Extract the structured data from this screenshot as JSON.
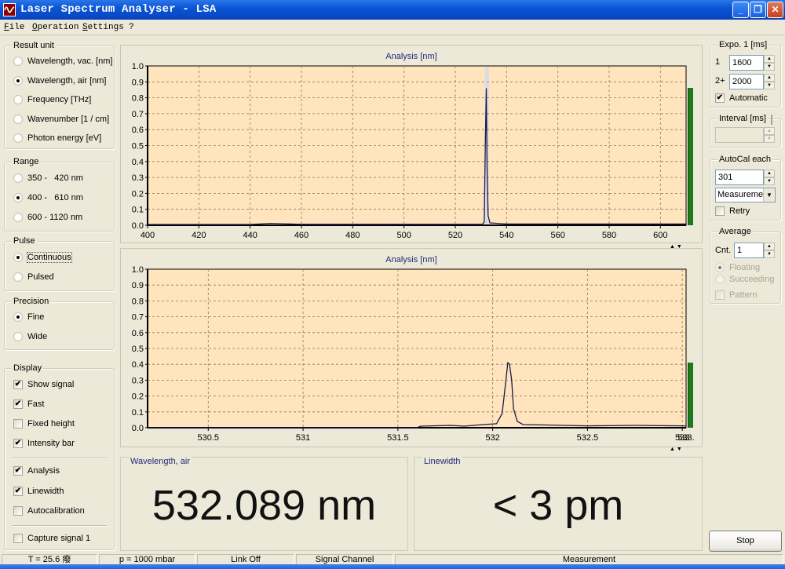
{
  "window": {
    "title": "Laser Spectrum Analyser - LSA",
    "controls": [
      "minimize",
      "restore",
      "close"
    ]
  },
  "menu": [
    "File",
    "Operation",
    "Settings",
    "?"
  ],
  "left_panel": {
    "result_unit": {
      "label": "Result unit",
      "options": [
        {
          "label": "Wavelength, vac.  [nm]",
          "selected": false
        },
        {
          "label": "Wavelength, air  [nm]",
          "selected": true
        },
        {
          "label": "Frequency  [THz]",
          "selected": false
        },
        {
          "label": "Wavenumber  [1 / cm]",
          "selected": false
        },
        {
          "label": "Photon energy  [eV]",
          "selected": false
        }
      ]
    },
    "range": {
      "label": "Range",
      "options": [
        {
          "label": "350 -   420 nm",
          "selected": false
        },
        {
          "label": "400 -   610 nm",
          "selected": true
        },
        {
          "label": "600 - 1120 nm",
          "selected": false
        }
      ]
    },
    "pulse": {
      "label": "Pulse",
      "options": [
        {
          "label": "Continuous",
          "selected": true
        },
        {
          "label": "Pulsed",
          "selected": false
        }
      ]
    },
    "precision": {
      "label": "Precision",
      "options": [
        {
          "label": "Fine",
          "selected": true
        },
        {
          "label": "Wide",
          "selected": false
        }
      ]
    },
    "display": {
      "label": "Display",
      "options": [
        {
          "label": "Show signal",
          "checked": true
        },
        {
          "label": "Fast",
          "checked": true
        },
        {
          "label": "Fixed height",
          "checked": false
        },
        {
          "label": "Intensity bar",
          "checked": true
        },
        {
          "label": "Analysis",
          "checked": true
        },
        {
          "label": "Linewidth",
          "checked": true
        },
        {
          "label": "Autocalibration",
          "checked": false
        },
        {
          "label": "Capture signal 1",
          "checked": false
        }
      ]
    }
  },
  "right_panel": {
    "expo": {
      "label": "Expo. 1  [ms]",
      "row1_label": "1",
      "row1_value": "1600",
      "row2_label": "2+",
      "row2_value": "2000",
      "automatic_label": "Automatic",
      "automatic_checked": true
    },
    "interval": {
      "label": "Interval [ms]",
      "enabled": false,
      "value": ""
    },
    "autocal": {
      "label": "AutoCal each",
      "value": "301",
      "mode": "Measurement",
      "mode_display": "Measuremer",
      "retry_label": "Retry",
      "retry_checked": false
    },
    "average": {
      "label": "Average",
      "cnt_label": "Cnt.",
      "cnt_value": "1",
      "floating_label": "Floating",
      "succeeding_label": "Succeeding",
      "pattern_label": "Pattern"
    },
    "stop_label": "Stop"
  },
  "results": {
    "wavelength_label": "Wavelength,  air",
    "wavelength_value": "532.089 nm",
    "linewidth_label": "Linewidth",
    "linewidth_value": "< 3 pm"
  },
  "status": {
    "temperature": "T = 25.6 癈",
    "pressure": "p = 1000 mbar",
    "link": "Link Off",
    "channel": "Signal Channel",
    "mode": "Measurement"
  },
  "chart_data": [
    {
      "type": "line",
      "title": "Analysis  [nm]",
      "xlabel": "",
      "ylabel": "",
      "xlim": [
        400,
        610
      ],
      "ylim": [
        0,
        1.0
      ],
      "grid": true,
      "x_ticks": [
        "400",
        "420",
        "440",
        "460",
        "480",
        "500",
        "520",
        "540",
        "560",
        "580",
        "600"
      ],
      "y_ticks": [
        "0.0",
        "0.1",
        "0.2",
        "0.3",
        "0.4",
        "0.5",
        "0.6",
        "0.7",
        "0.8",
        "0.9",
        "1.0"
      ],
      "highlight_range": [
        531.5,
        533.1
      ],
      "intensity_level": 0.86,
      "series": [
        {
          "name": "signal",
          "peak_x": 532.09,
          "peak_y": 0.86,
          "x": [
            400,
            420,
            440,
            448,
            460,
            480,
            500,
            520,
            530.5,
            531.3,
            531.7,
            532.09,
            532.4,
            532.8,
            533.5,
            540,
            560,
            580,
            600,
            610
          ],
          "y": [
            0.005,
            0.005,
            0.005,
            0.012,
            0.006,
            0.006,
            0.006,
            0.006,
            0.006,
            0.02,
            0.5,
            0.86,
            0.35,
            0.06,
            0.015,
            0.008,
            0.008,
            0.008,
            0.008,
            0.008
          ]
        }
      ]
    },
    {
      "type": "line",
      "title": "Analysis  [nm]",
      "xlabel": "",
      "ylabel": "",
      "xlim": [
        530.18,
        533.02
      ],
      "ylim": [
        0,
        1.0
      ],
      "grid": true,
      "x_ticks": [
        "530.5",
        "531",
        "531.5",
        "532",
        "532.5",
        "533"
      ],
      "x_tick_last_label": "533.",
      "y_ticks": [
        "0.0",
        "0.1",
        "0.2",
        "0.3",
        "0.4",
        "0.5",
        "0.6",
        "0.7",
        "0.8",
        "0.9",
        "1.0"
      ],
      "intensity_level": 0.41,
      "series": [
        {
          "name": "signal",
          "peak_x": 532.089,
          "peak_y": 0.41,
          "x": [
            530.18,
            531.0,
            531.6,
            531.62,
            531.78,
            531.85,
            531.95,
            532.02,
            532.05,
            532.07,
            532.08,
            532.089,
            532.1,
            532.11,
            532.13,
            532.16,
            532.25,
            532.5,
            532.75,
            533.0,
            533.02
          ],
          "y": [
            0.0,
            0.0,
            0.0,
            0.01,
            0.015,
            0.01,
            0.02,
            0.025,
            0.09,
            0.3,
            0.41,
            0.4,
            0.3,
            0.12,
            0.04,
            0.02,
            0.018,
            0.012,
            0.015,
            0.012,
            0.012
          ]
        }
      ]
    }
  ]
}
